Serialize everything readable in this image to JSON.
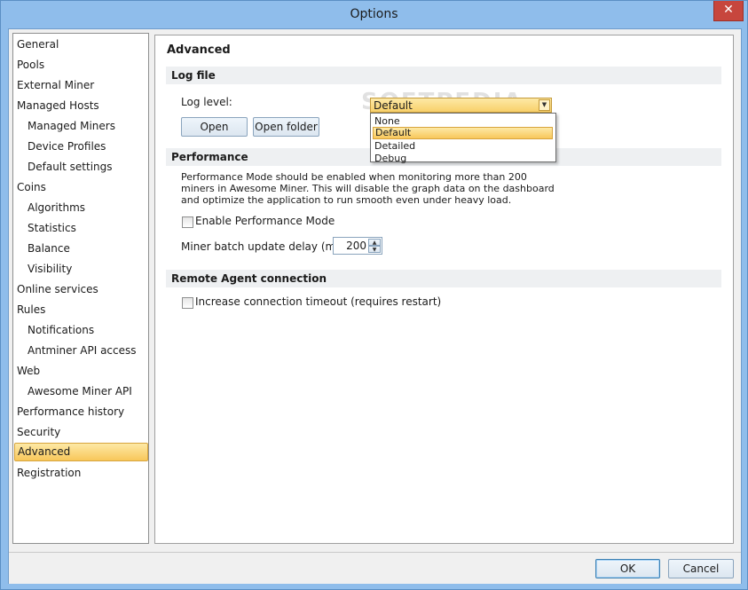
{
  "window": {
    "title": "Options",
    "close_glyph": "✕"
  },
  "sidebar": {
    "items": [
      {
        "label": "General",
        "level": 0
      },
      {
        "label": "Pools",
        "level": 0
      },
      {
        "label": "External Miner",
        "level": 0
      },
      {
        "label": "Managed Hosts",
        "level": 0
      },
      {
        "label": "Managed Miners",
        "level": 1
      },
      {
        "label": "Device Profiles",
        "level": 1
      },
      {
        "label": "Default settings",
        "level": 1
      },
      {
        "label": "Coins",
        "level": 0
      },
      {
        "label": "Algorithms",
        "level": 1
      },
      {
        "label": "Statistics",
        "level": 1
      },
      {
        "label": "Balance",
        "level": 1
      },
      {
        "label": "Visibility",
        "level": 1
      },
      {
        "label": "Online services",
        "level": 0
      },
      {
        "label": "Rules",
        "level": 0
      },
      {
        "label": "Notifications",
        "level": 1
      },
      {
        "label": "Antminer API access",
        "level": 1
      },
      {
        "label": "Web",
        "level": 0
      },
      {
        "label": "Awesome Miner API",
        "level": 1
      },
      {
        "label": "Performance history",
        "level": 0
      },
      {
        "label": "Security",
        "level": 0
      },
      {
        "label": "Advanced",
        "level": 0,
        "selected": true
      },
      {
        "label": "Registration",
        "level": 0
      }
    ]
  },
  "main": {
    "title": "Advanced",
    "log_file": {
      "header": "Log file",
      "log_level_label": "Log level:",
      "log_level_value": "Default",
      "log_level_options": [
        "None",
        "Default",
        "Detailed",
        "Debug"
      ],
      "open_button": "Open",
      "open_folder_button": "Open folder"
    },
    "performance": {
      "header": "Performance",
      "description": "Performance Mode should be enabled when monitoring more than 200 miners in Awesome Miner. This will disable the graph data on the dashboard and optimize the application to run smooth even under heavy load.",
      "enable_checkbox_label": "Enable Performance Mode",
      "enable_checked": false,
      "batch_delay_label": "Miner batch update delay (ms):",
      "batch_delay_value": "200"
    },
    "remote_agent": {
      "header": "Remote Agent connection",
      "timeout_checkbox_label": "Increase connection timeout (requires restart)",
      "timeout_checked": false
    },
    "watermark": "SOFTPEDIA"
  },
  "footer": {
    "ok_label": "OK",
    "cancel_label": "Cancel"
  },
  "colors": {
    "accent_selected": "#f8c75a",
    "title_bar": "#8fbdeb",
    "close_button": "#c7463d"
  }
}
